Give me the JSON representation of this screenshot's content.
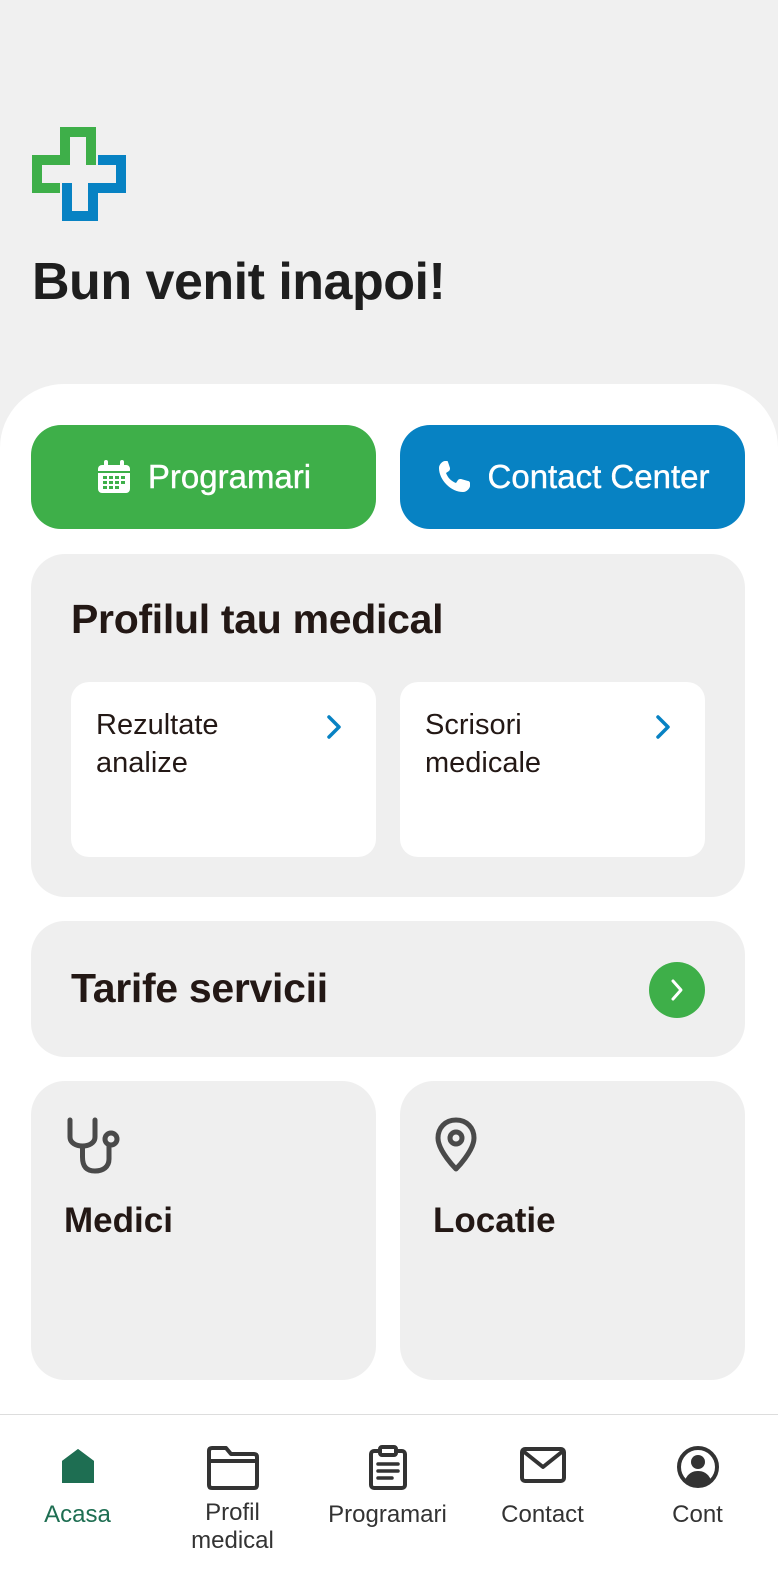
{
  "header": {
    "welcome": "Bun venit inapoi!",
    "logo_colors": {
      "green": "#3eaf49",
      "blue": "#0782c3"
    }
  },
  "actions": {
    "programari_label": "Programari",
    "programari_icon": "calendar-icon",
    "contact_label": "Contact Center",
    "contact_icon": "phone-icon",
    "programari_color": "#3eaf49",
    "contact_color": "#0782c3"
  },
  "profil": {
    "title": "Profilul tau medical",
    "items": [
      {
        "label": "Rezultate analize",
        "icon": "chevron-right-icon"
      },
      {
        "label": "Scrisori medicale",
        "icon": "chevron-right-icon"
      }
    ]
  },
  "tarife": {
    "title": "Tarife servicii",
    "icon": "arrow-right-circle-icon"
  },
  "tiles": [
    {
      "label": "Medici",
      "icon": "stethoscope-icon"
    },
    {
      "label": "Locatie",
      "icon": "location-pin-icon"
    }
  ],
  "nav": {
    "active": "Acasa",
    "active_color": "#1e6e52",
    "items": [
      {
        "label": "Acasa",
        "icon": "home-icon"
      },
      {
        "label": "Profil\nmedical",
        "icon": "folder-icon"
      },
      {
        "label": "Programari",
        "icon": "clipboard-icon"
      },
      {
        "label": "Contact",
        "icon": "mail-icon"
      },
      {
        "label": "Cont",
        "icon": "user-circle-icon"
      }
    ]
  }
}
